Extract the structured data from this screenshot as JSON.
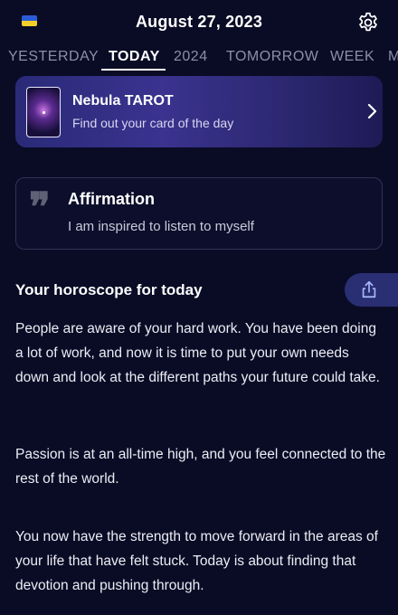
{
  "header": {
    "date": "August 27, 2023",
    "flag_icon": "ukraine-flag",
    "settings_icon": "gear-icon",
    "colors": {
      "flag_blue": "#2c5bd6",
      "flag_yellow": "#f4cf2a"
    }
  },
  "tabs": [
    {
      "label": "YESTERDAY",
      "active": false
    },
    {
      "label": "TODAY",
      "active": true
    },
    {
      "label": "2024",
      "active": false
    },
    {
      "label": "TOMORROW",
      "active": false
    },
    {
      "label": "WEEK",
      "active": false
    },
    {
      "label": "M",
      "active": false
    }
  ],
  "tarot": {
    "title": "Nebula TAROT",
    "subtitle": "Find out your card of the day",
    "chevron_icon": "chevron-right-icon",
    "accent": "#3a338f"
  },
  "affirmation": {
    "title": "Affirmation",
    "text": "I am inspired to listen to myself",
    "quote_icon": "quote-icon"
  },
  "horoscope": {
    "title": "Your horoscope for today",
    "share_icon": "share-icon",
    "paragraphs": [
      "People are aware of your hard work. You have been doing a lot of work, and now it is time to put your own needs down and look at the different paths your future could take.",
      "Passion is at an all-time high, and you feel connected to the rest of the world.",
      "You now have the strength to move forward in the areas of your life that have felt stuck. Today is about finding that devotion and pushing through."
    ]
  }
}
